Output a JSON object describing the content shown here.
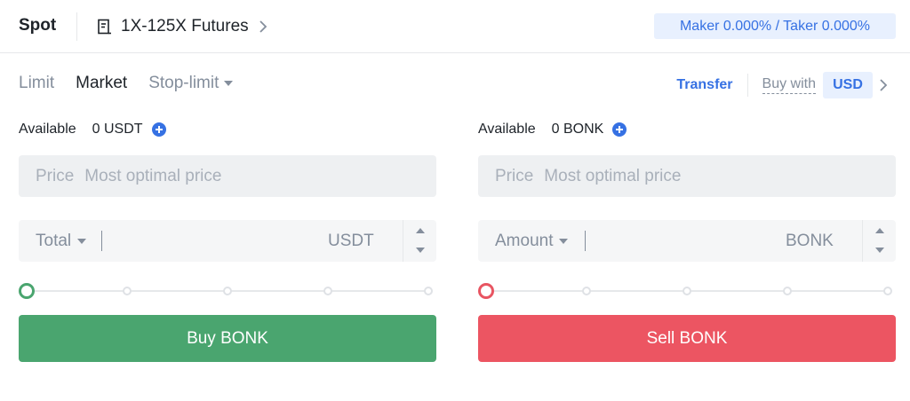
{
  "header": {
    "spot_label": "Spot",
    "futures_label": "1X-125X Futures",
    "futures_icon": "document-icon",
    "fee_text": "Maker 0.000% / Taker 0.000%"
  },
  "tabs": [
    {
      "label": "Limit",
      "active": false
    },
    {
      "label": "Market",
      "active": true
    },
    {
      "label": "Stop-limit",
      "active": false
    }
  ],
  "controls": {
    "transfer_label": "Transfer",
    "buy_with_label": "Buy with",
    "currency": "USD"
  },
  "buy": {
    "available_label": "Available",
    "available_value": "0 USDT",
    "price_label": "Price",
    "price_placeholder": "Most optimal price",
    "amount_selector": "Total",
    "amount_value": "",
    "amount_unit": "USDT",
    "slider_percent": 0,
    "button_label": "Buy BONK",
    "accent": "#4aa56f"
  },
  "sell": {
    "available_label": "Available",
    "available_value": "0 BONK",
    "price_label": "Price",
    "price_placeholder": "Most optimal price",
    "amount_selector": "Amount",
    "amount_value": "",
    "amount_unit": "BONK",
    "slider_percent": 0,
    "button_label": "Sell BONK",
    "accent": "#ec5562"
  },
  "colors": {
    "link_blue": "#3671e3",
    "badge_bg": "#e8f0fe",
    "field_bg": "#eef0f2"
  }
}
